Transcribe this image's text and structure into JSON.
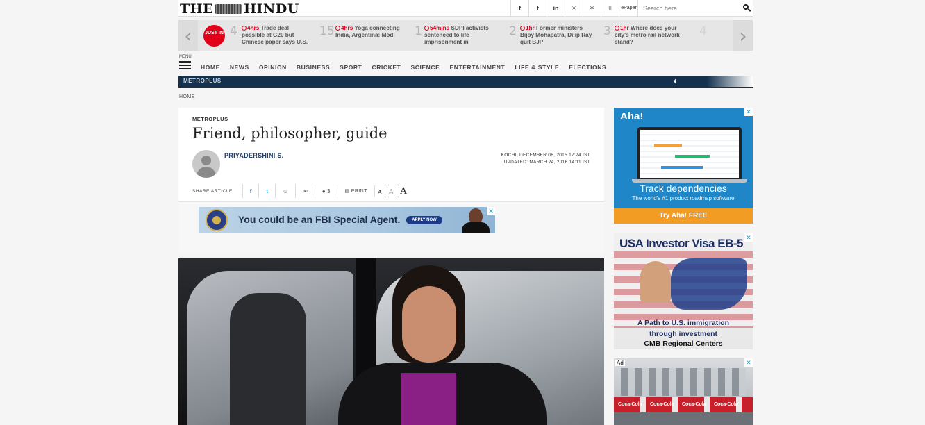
{
  "header": {
    "logo_left": "THE",
    "logo_right": "HINDU",
    "social": [
      "f",
      "t",
      "in",
      "◎",
      "✉",
      "▯",
      "ePaper"
    ],
    "search_placeholder": "Search here"
  },
  "ticker": {
    "badge": "JUST IN",
    "items": [
      {
        "num": "4",
        "time": "4hrs",
        "text_first": " Trade deal",
        "text_rest": "possible at G20 but Chinese paper says U.S."
      },
      {
        "num": "15",
        "time": "4hrs",
        "text_first": " Yoga connecting",
        "text_rest": "India, Argentina: Modi"
      },
      {
        "num": "1",
        "time": "54mins",
        "text_first": " SDPI activists",
        "text_rest": "sentenced to life imprisonment in"
      },
      {
        "num": "2",
        "time": "1hr",
        "text_first": " Former ministers",
        "text_rest": "Bijoy Mohapatra, Dilip Ray quit BJP"
      },
      {
        "num": "3",
        "time": "1hr",
        "text_first": " Where does your",
        "text_rest": "city's metro rail network stand?"
      }
    ],
    "next_num": "4"
  },
  "menu": {
    "label": "MENU",
    "items": [
      "HOME",
      "NEWS",
      "OPINION",
      "BUSINESS",
      "SPORT",
      "CRICKET",
      "SCIENCE",
      "ENTERTAINMENT",
      "LIFE & STYLE",
      "ELECTIONS"
    ]
  },
  "section_bar": "METROPLUS",
  "breadcrumb": "HOME",
  "article": {
    "section": "METROPLUS",
    "title": "Friend, philosopher, guide",
    "author": "PRIYADERSHINI S.",
    "dateline": "KOCHI, DECEMBER 06, 2015 17:24 IST",
    "updated": "UPDATED: MARCH 24, 2016 14:11 IST",
    "share_label": "SHARE ARTICLE",
    "comments": "3",
    "print": "PRINT",
    "font_sizes": [
      "A",
      "A",
      "A"
    ]
  },
  "ads": {
    "fbi_text": "You could be an FBI Special Agent.",
    "fbi_button": "APPLY NOW",
    "aha_logo": "Aha!",
    "aha_head": "Track dependencies",
    "aha_sub": "The world's #1 product roadmap software",
    "aha_cta": "Try Aha! FREE",
    "visa_title": "USA Investor Visa EB-5",
    "visa_l1": "A Path to U.S. immigration",
    "visa_l2": "through investment",
    "visa_l3": "CMB Regional Centers",
    "ad_tag": "Ad",
    "coke": "Coca-Cola"
  }
}
